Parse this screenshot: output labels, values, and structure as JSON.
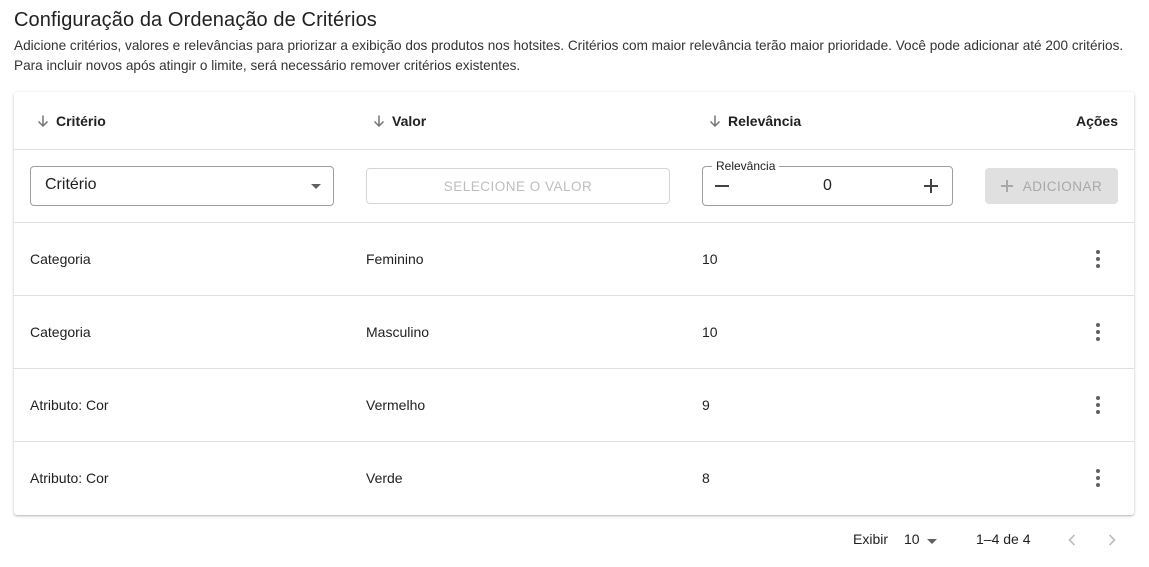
{
  "page": {
    "title": "Configuração da Ordenação de Critérios",
    "description": "Adicione critérios, valores e relevâncias para priorizar a exibição dos produtos nos hotsites. Critérios com maior relevância terão maior prioridade. Você pode adicionar até 200 critérios. Para incluir novos após atingir o limite, será necessário remover critérios existentes."
  },
  "table": {
    "columns": {
      "criterio": "Critério",
      "valor": "Valor",
      "relevancia": "Relevância",
      "acoes": "Ações"
    },
    "form": {
      "criterio_select": "Critério",
      "valor_button": "SELECIONE O VALOR",
      "relevancia_label": "Relevância",
      "relevancia_value": "0",
      "add_button": "ADICIONAR"
    },
    "rows": [
      {
        "criterio": "Categoria",
        "valor": "Feminino",
        "relevancia": "10"
      },
      {
        "criterio": "Categoria",
        "valor": "Masculino",
        "relevancia": "10"
      },
      {
        "criterio": "Atributo: Cor",
        "valor": "Vermelho",
        "relevancia": "9"
      },
      {
        "criterio": "Atributo: Cor",
        "valor": "Verde",
        "relevancia": "8"
      }
    ]
  },
  "pagination": {
    "show_label": "Exibir",
    "page_size": "10",
    "range": "1–4 de 4"
  },
  "icons": {
    "sort": "arrow-down-icon",
    "actions": "more-vert-icon",
    "prev": "chevron-left-icon",
    "next": "chevron-right-icon"
  },
  "colors": {
    "text": "#212121",
    "border": "#e0e0e0",
    "disabled": "#bdbdbd",
    "disabled_bg": "#e0e0e0"
  }
}
